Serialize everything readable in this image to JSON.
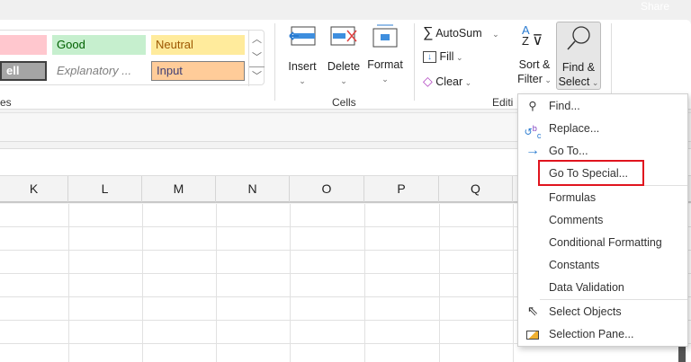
{
  "top": {
    "share": "Share"
  },
  "styles": {
    "good": "Good",
    "neutral": "Neutral",
    "bad_cell": "ell",
    "explanatory": "Explanatory ...",
    "input": "Input",
    "group": "es"
  },
  "cells": {
    "insert": "Insert",
    "delete": "Delete",
    "format": "Format",
    "group": "Cells"
  },
  "editing": {
    "autosum": "AutoSum",
    "fill": "Fill",
    "clear": "Clear",
    "sort": "Sort &",
    "filter": "Filter",
    "find": "Find &",
    "select": "Select",
    "group": "Editi"
  },
  "columns": [
    "K",
    "L",
    "M",
    "N",
    "O",
    "P",
    "Q"
  ],
  "menu": {
    "items": [
      "Find...",
      "Replace...",
      "Go To...",
      "Go To Special...",
      "Formulas",
      "Comments",
      "Conditional Formatting",
      "Constants",
      "Data Validation",
      "Select Objects",
      "Selection Pane..."
    ]
  },
  "colors": {
    "highlight": "#e0141e",
    "good_bg": "#c6efce",
    "neutral_bg": "#ffeb9c",
    "input_bg": "#ffcc99"
  }
}
